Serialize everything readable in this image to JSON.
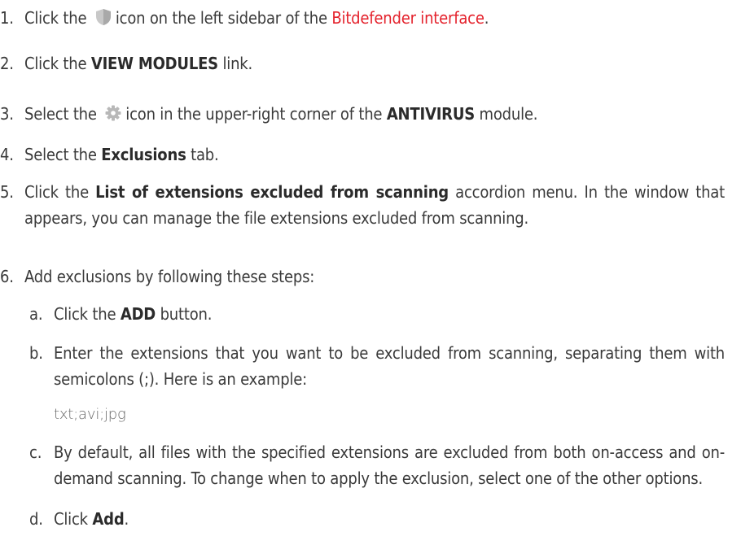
{
  "steps": [
    {
      "num": "1.",
      "pre": "Click the",
      "icon": "shield-icon",
      "mid": "icon on the left sidebar of the",
      "link": "Bitdefender interface",
      "post": "."
    },
    {
      "num": "2.",
      "pre": "Click the",
      "bold": "VIEW MODULES",
      "post": "link."
    },
    {
      "num": "3.",
      "pre": "Select the",
      "icon": "gear-icon",
      "mid": "icon in the upper-right corner of the",
      "bold": "ANTIVIRUS",
      "post": "module."
    },
    {
      "num": "4.",
      "pre": "Select the",
      "bold": "Exclusions",
      "post": "tab."
    },
    {
      "num": "5.",
      "pre": "Click the",
      "bold": "List of extensions excluded from scanning",
      "post": "accordion menu. In the window that appears, you can manage the file extensions excluded from scanning."
    },
    {
      "num": "6.",
      "text": "Add exclusions by following these steps:"
    }
  ],
  "substeps": [
    {
      "letter": "a.",
      "pre": "Click the",
      "bold": "ADD",
      "post": "button."
    },
    {
      "letter": "b.",
      "text": "Enter the extensions that you want to be excluded from scanning, separating them with semicolons (;). Here is an example:",
      "example": "txt;avi;jpg"
    },
    {
      "letter": "c.",
      "text": "By default, all files with the specified extensions are excluded from both on-access and on-demand scanning. To change when to apply the exclusion, select one of the other options."
    },
    {
      "letter": "d.",
      "pre": "Click",
      "bold": "Add",
      "post": "."
    }
  ]
}
